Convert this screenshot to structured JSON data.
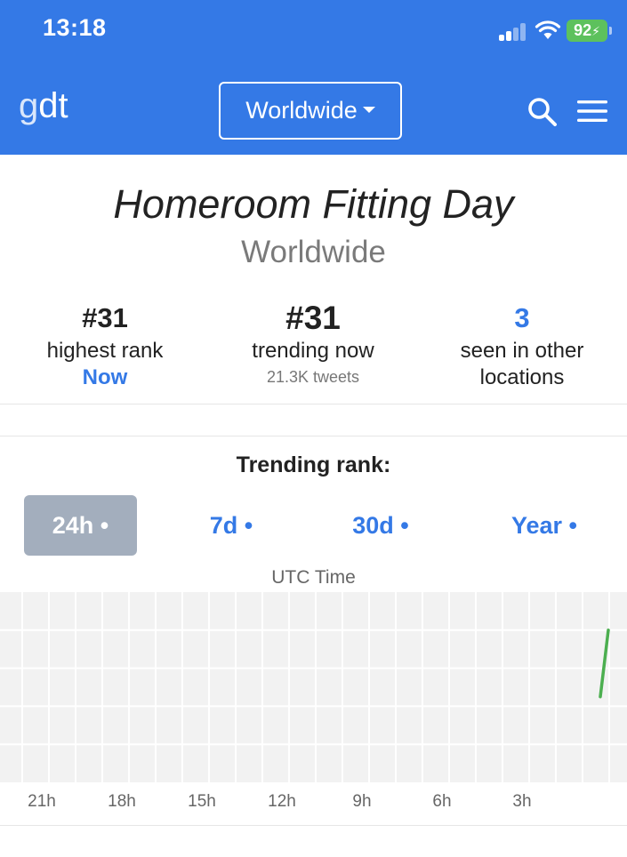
{
  "status_bar": {
    "time": "13:18",
    "battery": "92"
  },
  "header": {
    "logo_g": "g",
    "logo_dt": "dt",
    "location_dropdown": "Worldwide",
    "colors": {
      "bar": "#3479e6",
      "accent": "#3479e6"
    }
  },
  "trend": {
    "title": "Homeroom Fitting Day",
    "location": "Worldwide"
  },
  "stats": {
    "highest_rank": {
      "value": "#31",
      "label": "highest rank",
      "sub": "Now"
    },
    "trending_now": {
      "value": "#31",
      "label": "trending now",
      "sub": "21.3K tweets"
    },
    "other_locations": {
      "value": "3",
      "label_line1": "seen in other",
      "label_line2": "locations"
    }
  },
  "rank_section": {
    "heading": "Trending rank:",
    "tabs": [
      {
        "label": "24h •",
        "active": true
      },
      {
        "label": "7d •",
        "active": false
      },
      {
        "label": "30d •",
        "active": false
      },
      {
        "label": "Year •",
        "active": false
      }
    ],
    "axis_label": "UTC Time"
  },
  "chart_data": {
    "type": "line",
    "title": "Trending rank:",
    "xlabel": "UTC Time",
    "ylabel": "",
    "x_tick_labels": [
      "21h",
      "18h",
      "15h",
      "12h",
      "9h",
      "6h",
      "3h"
    ],
    "series": [
      {
        "color": "#4caf50",
        "x_hours_ago": [
          0.3,
          0
        ],
        "rank": [
          31,
          24
        ]
      }
    ],
    "grid": true,
    "colors": {
      "background": "#f2f2f2",
      "grid": "#ffffff",
      "line": "#4caf50"
    }
  }
}
